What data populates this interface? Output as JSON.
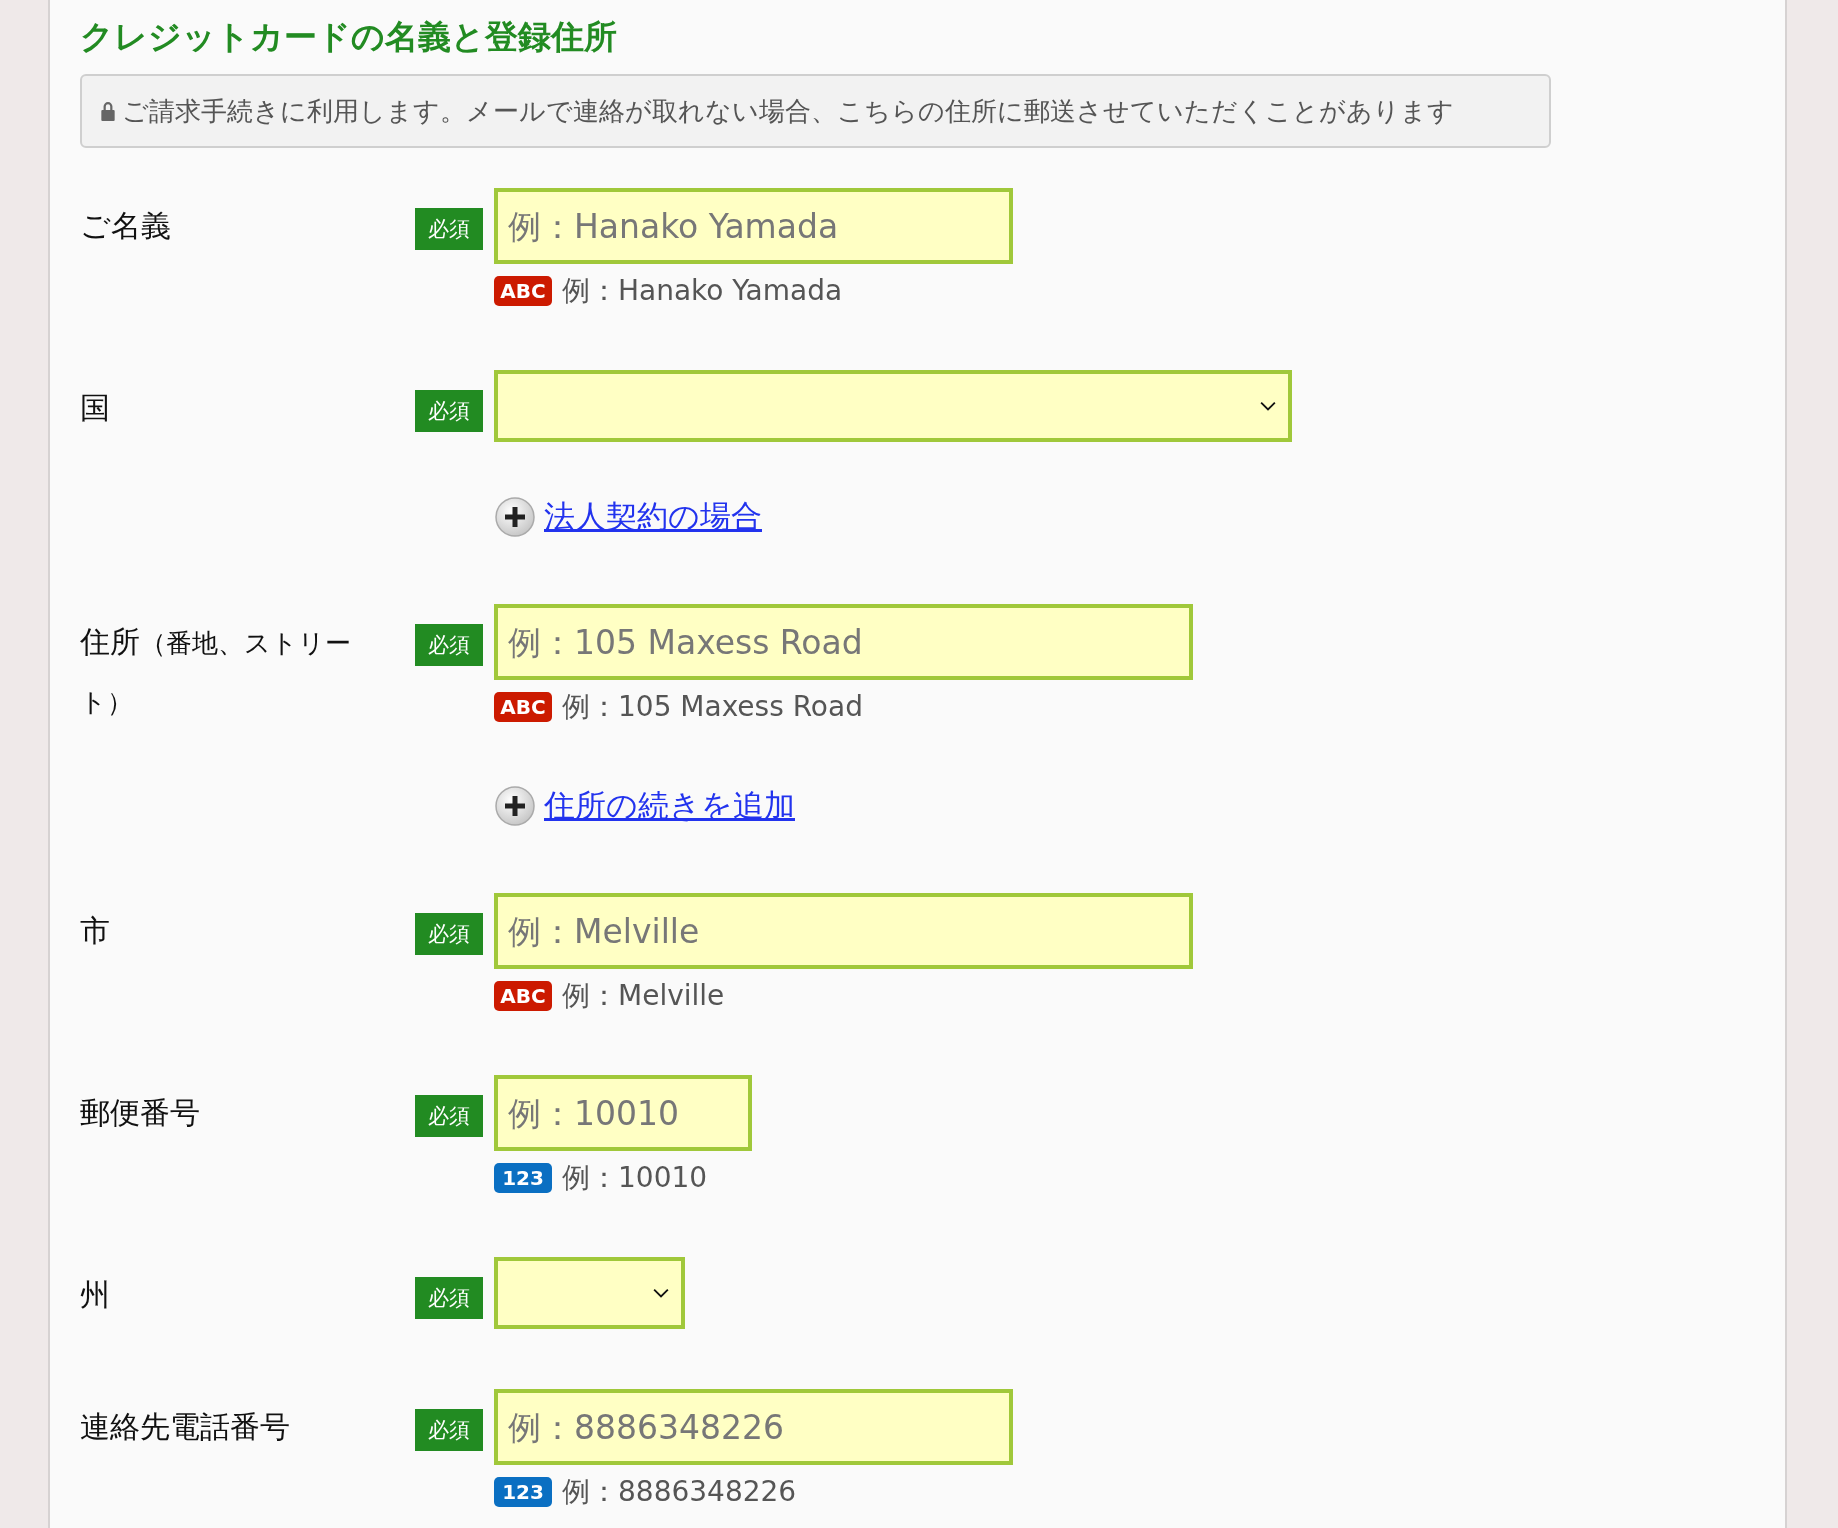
{
  "heading": "クレジットカードの名義と登録住所",
  "notice": "ご請求手続きに利用します。メールで連絡が取れない場合、こちらの住所に郵送させていただくことがあります",
  "fields": [
    {
      "kind": "text",
      "label": "ご名義",
      "badge": "必須",
      "placeholder": "例：Hanako Yamada",
      "hint": {
        "kind": "alpha",
        "icon": "ABC",
        "text": "例：Hanako Yamada"
      }
    },
    {
      "kind": "select",
      "label": "国",
      "badge": "必須"
    },
    {
      "kind": "link",
      "text": "法人契約の場合"
    },
    {
      "kind": "text",
      "label": "住所",
      "note": "（番地、ストリート）",
      "badge": "必須",
      "placeholder": "例：105 Maxess Road",
      "hint": {
        "kind": "alpha",
        "icon": "ABC",
        "text": "例：105 Maxess Road"
      }
    },
    {
      "kind": "link",
      "text": "住所の続きを追加"
    },
    {
      "kind": "text",
      "label": "市",
      "badge": "必須",
      "placeholder": "例：Melville",
      "hint": {
        "kind": "alpha",
        "icon": "ABC",
        "text": "例：Melville"
      }
    },
    {
      "kind": "text",
      "label": "郵便番号",
      "badge": "必須",
      "placeholder": "例：10010",
      "hint": {
        "kind": "numeric",
        "icon": "123",
        "text": "例：10010"
      }
    },
    {
      "kind": "select",
      "label": "州",
      "badge": "必須"
    },
    {
      "kind": "text",
      "label": "連絡先電話番号",
      "badge": "必須",
      "placeholder": "例：8886348226",
      "hint": {
        "kind": "numeric",
        "icon": "123",
        "text": "例：8886348226"
      }
    }
  ]
}
